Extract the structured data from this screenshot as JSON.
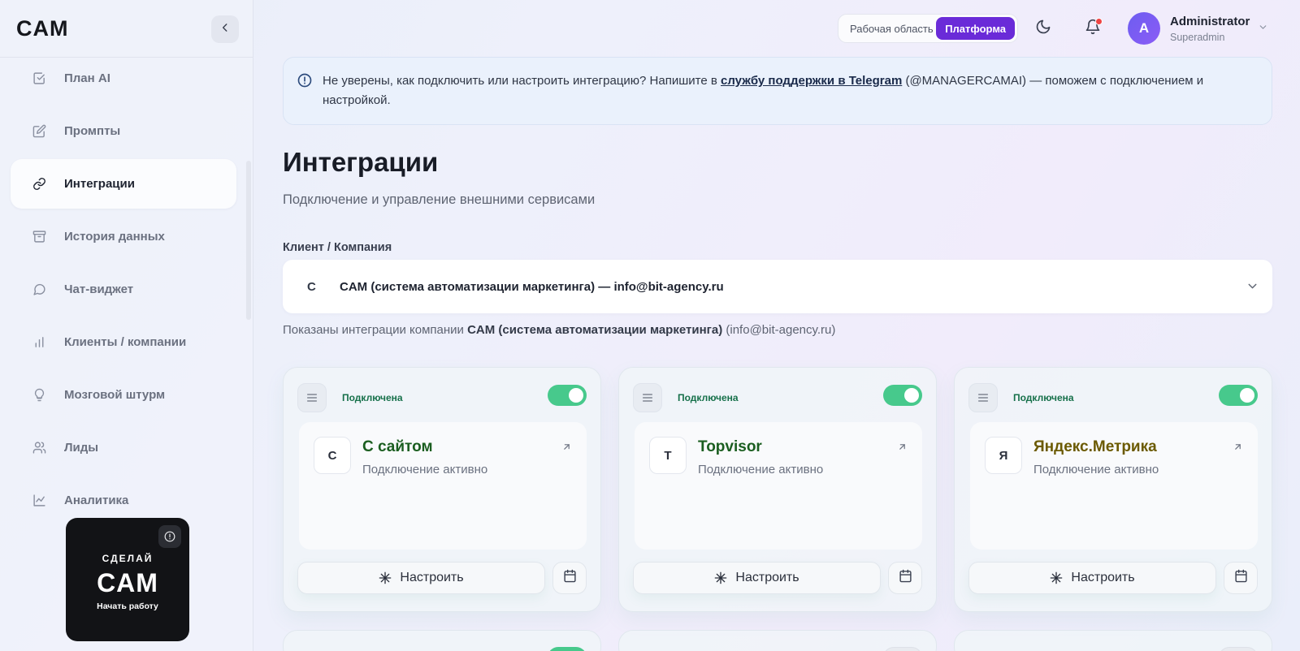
{
  "sidebar": {
    "logo": "CAM",
    "items": [
      {
        "label": "План AI",
        "icon": "checkbox-icon"
      },
      {
        "label": "Промпты",
        "icon": "edit-icon"
      },
      {
        "label": "Интеграции",
        "icon": "link-icon",
        "active": true
      },
      {
        "label": "История данных",
        "icon": "archive-icon"
      },
      {
        "label": "Чат-виджет",
        "icon": "chat-icon"
      },
      {
        "label": "Клиенты / компании",
        "icon": "bar-chart-icon"
      },
      {
        "label": "Мозговой штурм",
        "icon": "lightbulb-icon"
      },
      {
        "label": "Лиды",
        "icon": "users-icon"
      },
      {
        "label": "Аналитика",
        "icon": "line-chart-icon"
      }
    ],
    "promo": {
      "top": "СДЕЛАЙ",
      "logo": "CAM",
      "sub": "Начать работу"
    }
  },
  "header": {
    "workspace_label": "Рабочая область",
    "platform_label": "Платформа",
    "user": {
      "initial": "A",
      "name": "Administrator",
      "role": "Superadmin"
    }
  },
  "alert": {
    "before": "Не уверены, как подключить или настроить интеграцию? Напишите в ",
    "link": "службу поддержки в Telegram",
    "after": " (@MANAGERCAMAI) — поможем с подключением и настройкой."
  },
  "page": {
    "title": "Интеграции",
    "subtitle": "Подключение и управление внешними сервисами",
    "client_label": "Клиент / Компания",
    "client_letter": "C",
    "client_value": "CAM (система автоматизации маркетинга) — info@bit-agency.ru",
    "shown_prefix": "Показаны интеграции компании ",
    "shown_company": "CAM (система автоматизации маркетинга)",
    "shown_suffix": " (info@bit-agency.ru)"
  },
  "cards": [
    {
      "status": "Подключена",
      "letter": "С",
      "title": "С сайтом",
      "title_color": "#1b5e20",
      "desc": "Подключение активно",
      "button": "Настроить"
    },
    {
      "status": "Подключена",
      "letter": "T",
      "title": "Topvisor",
      "title_color": "#1b5e20",
      "desc": "Подключение активно",
      "button": "Настроить"
    },
    {
      "status": "Подключена",
      "letter": "Я",
      "title": "Яндекс.Метрика",
      "title_color": "#6b5a00",
      "desc": "Подключение активно",
      "button": "Настроить"
    }
  ],
  "colors": {
    "accent": "#6a2bd8",
    "toggle_on": "#47c98c",
    "status_green": "#16704a"
  }
}
